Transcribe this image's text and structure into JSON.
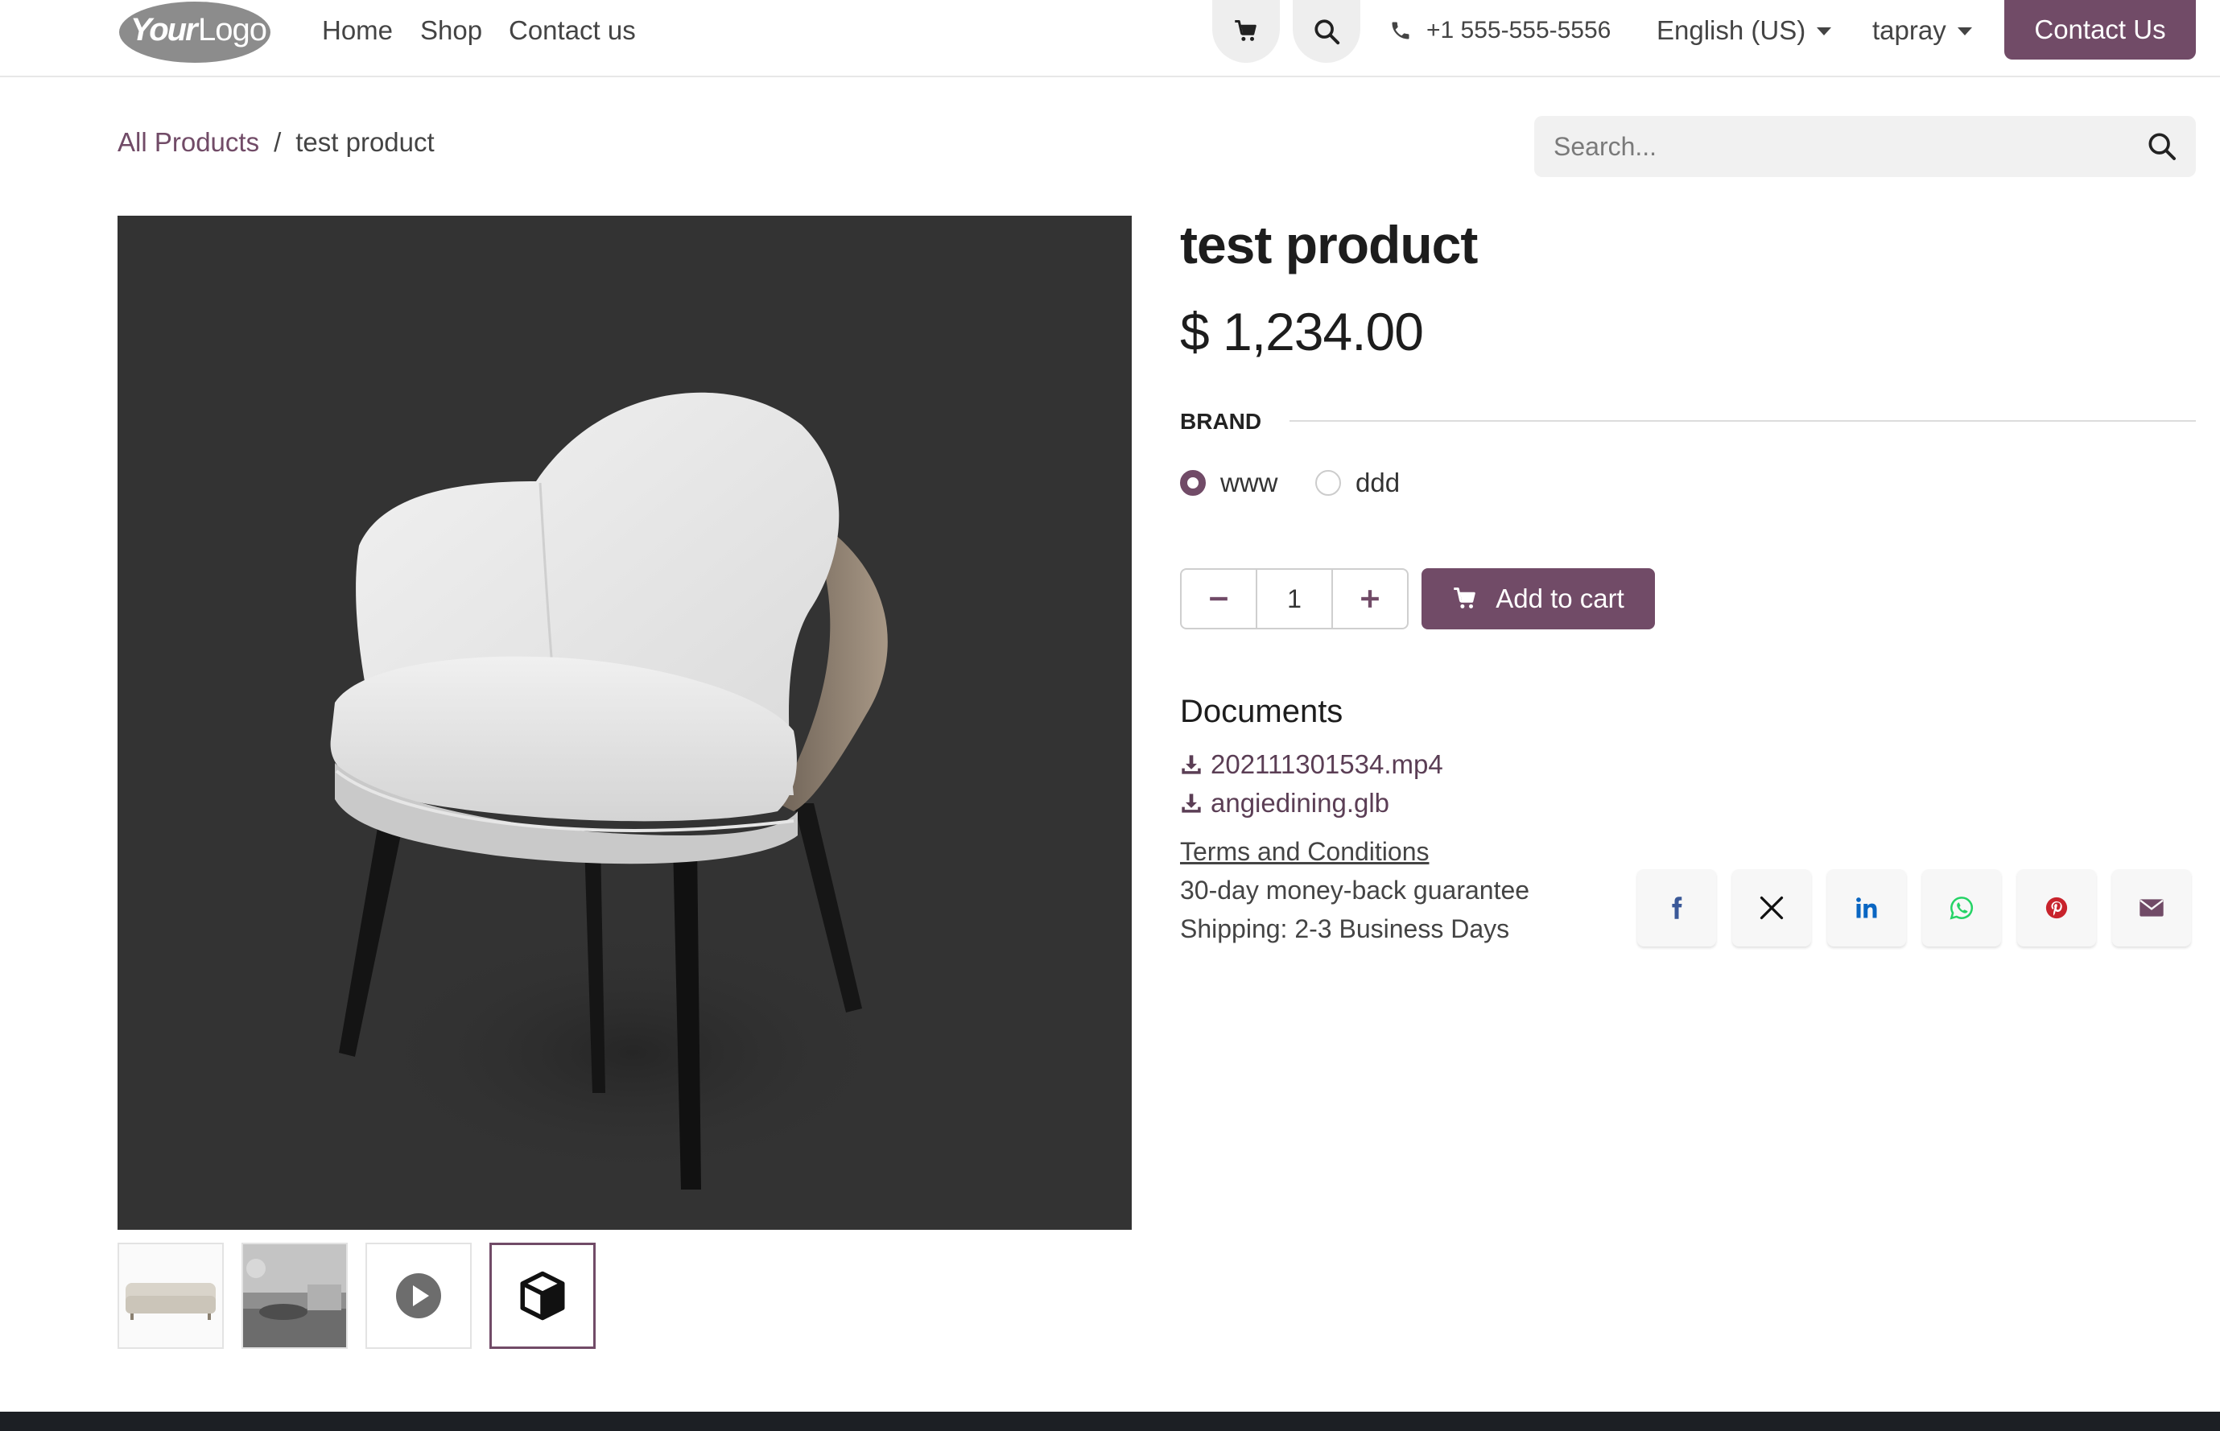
{
  "header": {
    "logo_text": "YourLogo",
    "nav": [
      "Home",
      "Shop",
      "Contact us"
    ],
    "phone": "+1 555-555-5556",
    "language": "English (US)",
    "user": "tapray",
    "contact_button": "Contact Us"
  },
  "breadcrumb": {
    "parent": "All Products",
    "separator": "/",
    "current": "test product"
  },
  "search": {
    "placeholder": "Search..."
  },
  "product": {
    "title": "test product",
    "price": "$ 1,234.00",
    "attribute": {
      "label": "BRAND",
      "options": [
        "www",
        "ddd"
      ],
      "selected": "www"
    },
    "quantity": "1",
    "add_to_cart": "Add to cart"
  },
  "documents": {
    "title": "Documents",
    "files": [
      "202111301534.mp4",
      "angiedining.glb"
    ]
  },
  "info": {
    "terms": "Terms and Conditions",
    "guarantee": "30-day money-back guarantee",
    "shipping": "Shipping: 2-3 Business Days"
  },
  "share": [
    "facebook-icon",
    "x-icon",
    "linkedin-icon",
    "whatsapp-icon",
    "pinterest-icon",
    "email-icon"
  ],
  "colors": {
    "brand": "#714b67",
    "image_bg": "#333333",
    "facebook": "#3b5998",
    "linkedin": "#0a66c2",
    "whatsapp": "#25d366",
    "pinterest": "#c8232c",
    "email": "#714b67"
  }
}
